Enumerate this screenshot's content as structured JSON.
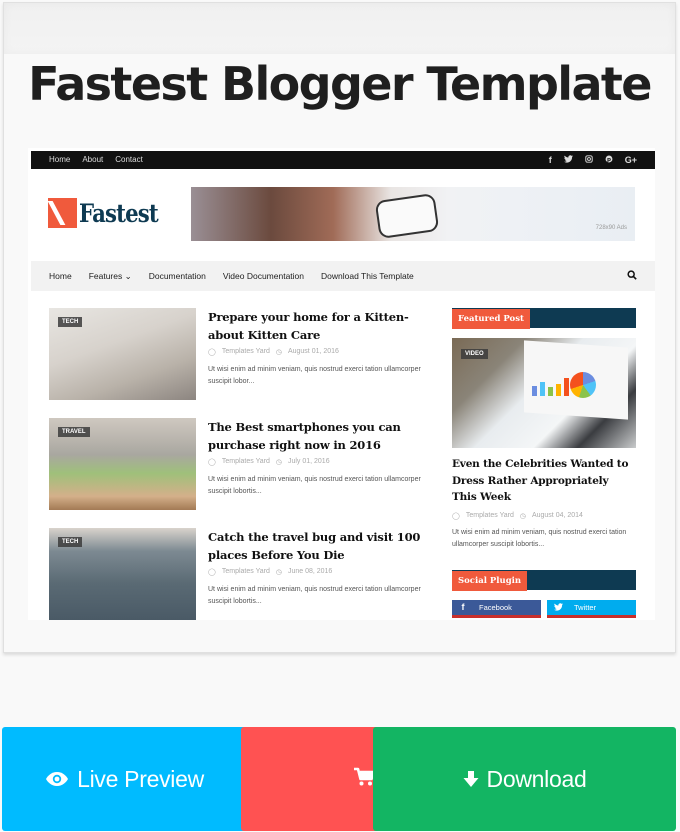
{
  "card": {
    "title": "Fastest Blogger Template"
  },
  "preview": {
    "topbar": {
      "links": [
        "Home",
        "About",
        "Contact"
      ],
      "social_icons": [
        "facebook-icon",
        "twitter-icon",
        "instagram-icon",
        "pinterest-icon",
        "google-plus-icon"
      ],
      "social_glyphs": [
        "f",
        "🐦",
        "◎",
        "℗",
        "G+"
      ]
    },
    "logo": {
      "text": "Fastest"
    },
    "ad": {
      "label": "728x90 Ads"
    },
    "nav": {
      "items": [
        "Home",
        "Features ⌄",
        "Documentation",
        "Video Documentation",
        "Download This Template"
      ]
    },
    "posts": [
      {
        "tag": "TECH",
        "title": "Prepare your home for a Kitten-about Kitten Care",
        "author": "Templates Yard",
        "date": "August 01, 2016",
        "excerpt": "Ut wisi enim ad minim veniam, quis nostrud exerci tation ullamcorper suscipit lobor..."
      },
      {
        "tag": "TRAVEL",
        "title": "The Best smartphones you can purchase right now in 2016",
        "author": "Templates Yard",
        "date": "July 01, 2016",
        "excerpt": "Ut wisi enim ad minim veniam, quis nostrud exerci tation ullamcorper suscipit lobortis..."
      },
      {
        "tag": "TECH",
        "title": "Catch the travel bug and visit 100 places Before You Die",
        "author": "Templates Yard",
        "date": "June 08, 2016",
        "excerpt": "Ut wisi enim ad minim veniam, quis nostrud exerci tation ullamcorper suscipit lobortis..."
      }
    ],
    "featured": {
      "heading": "Featured Post",
      "tag": "VIDEO",
      "title": "Even the Celebrities Wanted to Dress Rather Appropriately This Week",
      "author": "Templates Yard",
      "date": "August 04, 2014",
      "excerpt": "Ut wisi enim ad minim veniam, quis nostrud exerci tation ullamcorper suscipit lobortis..."
    },
    "social_plugin": {
      "heading": "Social Plugin",
      "buttons": [
        {
          "label": "Facebook",
          "glyph": "f",
          "color": "#3b5998"
        },
        {
          "label": "Twitter",
          "glyph": "🐦",
          "color": "#00acee"
        }
      ]
    },
    "colors": {
      "accent": "#f05a3c",
      "navy": "#0e3a52"
    }
  },
  "actions": {
    "live_preview": "Live Preview",
    "buy": "",
    "download": "Download",
    "colors": {
      "live_preview": "#00bbff",
      "buy": "#ff5252",
      "download": "#13b563"
    }
  }
}
